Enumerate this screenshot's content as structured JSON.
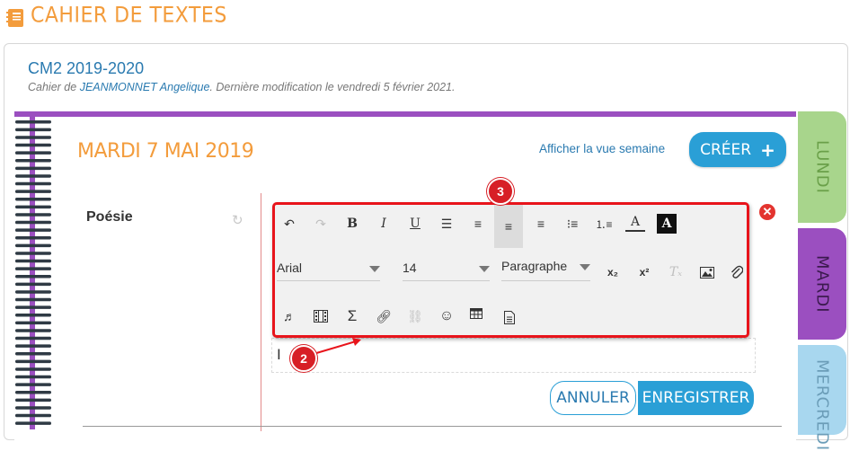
{
  "header": {
    "title": "CAHIER DE TEXTES",
    "icon": "notebook-icon"
  },
  "class_info": {
    "title": "CM2 2019-2020",
    "subtitle_prefix": "Cahier de ",
    "author": "JEANMONNET Angelique",
    "subtitle_suffix": ". Dernière modification le vendredi 5 février 2021."
  },
  "day": {
    "title": "MARDI 7 MAI 2019",
    "week_link": "Afficher la vue semaine",
    "create_label": "CRÉER"
  },
  "tabs": [
    {
      "label": "LUNDI"
    },
    {
      "label": "MARDI"
    },
    {
      "label": "MERCREDI"
    }
  ],
  "entry": {
    "subject": "Poésie"
  },
  "toolbar": {
    "font": "Arial",
    "size": "14",
    "format": "Paragraphe",
    "row1_icons": [
      "undo-icon",
      "redo-icon",
      "bold-icon",
      "italic-icon",
      "underline-icon",
      "justify-icon",
      "align-center-icon",
      "align-left-icon",
      "align-right-icon",
      "bullet-list-icon",
      "numbered-list-icon",
      "text-color-icon",
      "background-color-icon"
    ],
    "row2_icons": [
      "subscript-icon",
      "superscript-icon",
      "clear-format-icon",
      "image-icon",
      "attachment-icon"
    ],
    "row3_icons": [
      "audio-icon",
      "video-icon",
      "formula-icon",
      "link-icon",
      "unlink-icon",
      "emoji-icon",
      "table-icon",
      "document-icon"
    ]
  },
  "markers": {
    "toolbar": "3",
    "editor": "2"
  },
  "actions": {
    "cancel_label": "ANNULER",
    "save_label": "ENREGISTRER"
  },
  "colors": {
    "accent_orange": "#f39c3c",
    "primary_blue": "#2a9fd6",
    "tuesday_purple": "#9b4fc0",
    "monday_green": "#a8d58c",
    "wednesday_blue": "#a8d7ef",
    "annotation_red": "#e8141b"
  }
}
